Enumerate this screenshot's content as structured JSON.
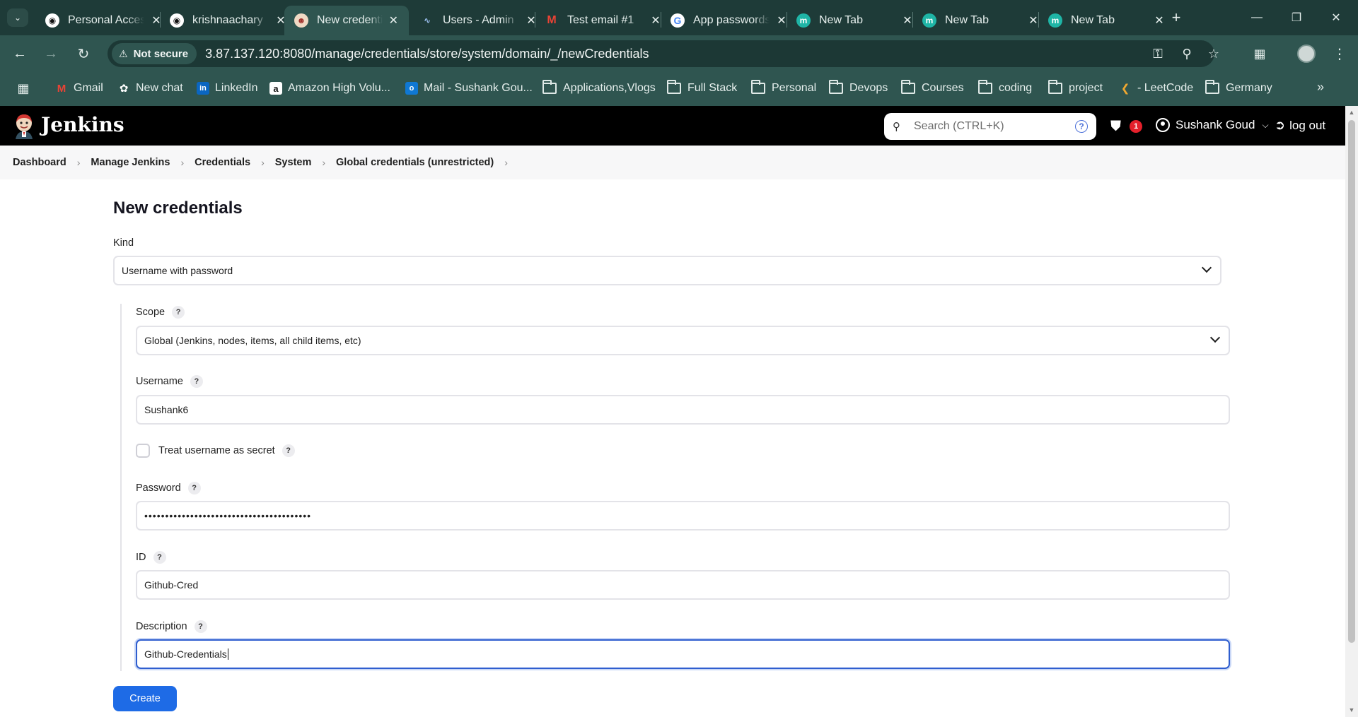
{
  "browser": {
    "tabs": [
      {
        "title": "Personal Access",
        "icon": "github-icon"
      },
      {
        "title": "krishnaachary",
        "icon": "github-icon"
      },
      {
        "title": "New credentials",
        "icon": "jenkins-icon",
        "active": true
      },
      {
        "title": "Users - Admin",
        "icon": "jenkins-icon"
      },
      {
        "title": "Test email #1",
        "icon": "gmail-icon"
      },
      {
        "title": "App passwords",
        "icon": "google-icon"
      },
      {
        "title": "New Tab",
        "icon": "m-icon"
      },
      {
        "title": "New Tab",
        "icon": "m-icon"
      },
      {
        "title": "New Tab",
        "icon": "m-icon"
      }
    ],
    "security_chip": "Not secure",
    "url": "3.87.137.120:8080/manage/credentials/store/system/domain/_/newCredentials",
    "bookmarks": [
      {
        "label": "Gmail",
        "kind": "gmail"
      },
      {
        "label": "New chat",
        "kind": "chatgpt"
      },
      {
        "label": "LinkedIn",
        "kind": "linkedin"
      },
      {
        "label": "Amazon High Volu...",
        "kind": "amazon"
      },
      {
        "label": "Mail - Sushank Gou...",
        "kind": "outlook"
      },
      {
        "label": "Applications,Vlogs",
        "kind": "folder"
      },
      {
        "label": "Full Stack",
        "kind": "folder"
      },
      {
        "label": "Personal",
        "kind": "folder"
      },
      {
        "label": "Devops",
        "kind": "folder"
      },
      {
        "label": "Courses",
        "kind": "folder"
      },
      {
        "label": "coding",
        "kind": "folder"
      },
      {
        "label": "project",
        "kind": "folder"
      },
      {
        "label": "- LeetCode",
        "kind": "leetcode"
      },
      {
        "label": "Germany",
        "kind": "folder"
      }
    ]
  },
  "header": {
    "brand": "Jenkins",
    "search_placeholder": "Search (CTRL+K)",
    "security_badge_count": "1",
    "user_name": "Sushank Goud",
    "logout_label": "log out"
  },
  "breadcrumb": [
    "Dashboard",
    "Manage Jenkins",
    "Credentials",
    "System",
    "Global credentials (unrestricted)"
  ],
  "form": {
    "title": "New credentials",
    "kind_label": "Kind",
    "kind_value": "Username with password",
    "scope_label": "Scope",
    "scope_value": "Global (Jenkins, nodes, items, all child items, etc)",
    "username_label": "Username",
    "username_value": "Sushank6",
    "treat_secret_label": "Treat username as secret",
    "password_label": "Password",
    "password_mask": "••••••••••••••••••••••••••••••••••••••••",
    "id_label": "ID",
    "id_value": "Github-Cred",
    "description_label": "Description",
    "description_value": "Github-Credentials",
    "help_glyph": "?",
    "create_label": "Create"
  },
  "colors": {
    "browser_frame": "#1e3b38",
    "browser_toolbar": "#2f5550",
    "jenkins_header": "#000000",
    "primary_button": "#1e6be6",
    "focus_ring": "#2f5ecf",
    "badge": "#e5202b"
  }
}
